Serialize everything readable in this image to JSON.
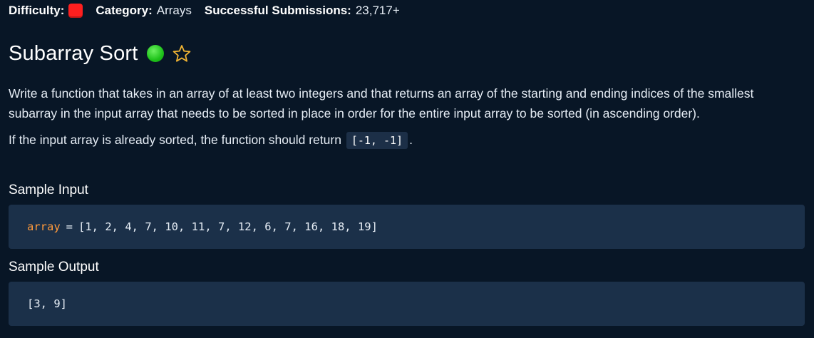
{
  "meta": {
    "difficulty_label": "Difficulty:",
    "category_label": "Category:",
    "category_value": "Arrays",
    "submissions_label": "Successful Submissions:",
    "submissions_value": "23,717+",
    "difficulty_color": "#ff1f1f"
  },
  "problem": {
    "title": "Subarray Sort",
    "status_color": "#1ec21a",
    "star_icon": "star-outline-icon",
    "star_color": "#f2b533",
    "description_1": "Write a function that takes in an array of at least two integers and that returns an array of the starting and ending indices of the smallest subarray in the input array that needs to be sorted in place in order for the entire input array to be sorted (in ascending order).",
    "description_2_prefix": "If the input array is already sorted, the function should return",
    "description_2_code": "[-1, -1]",
    "description_2_suffix": "."
  },
  "sample_input": {
    "title": "Sample Input",
    "var_name": "array",
    "operator": "=",
    "value": "[1, 2, 4, 7, 10, 11, 7, 12, 6, 7, 16, 18, 19]"
  },
  "sample_output": {
    "title": "Sample Output",
    "value": "[3, 9]"
  }
}
